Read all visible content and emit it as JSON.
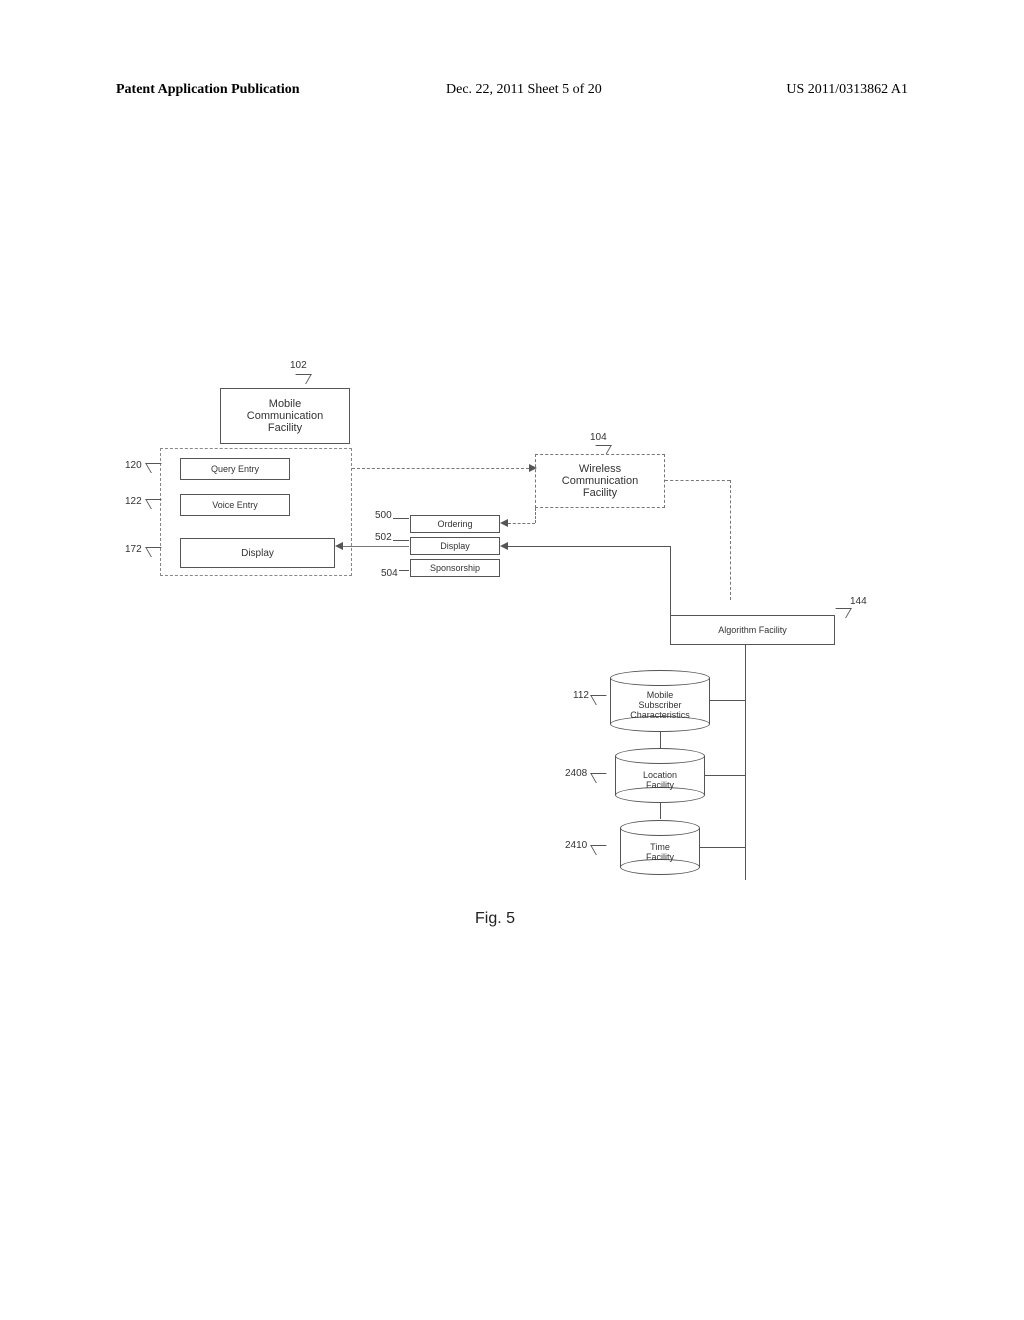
{
  "header": {
    "left": "Patent Application Publication",
    "mid": "Dec. 22, 2011  Sheet 5 of 20",
    "right": "US 2011/0313862 A1"
  },
  "labels": {
    "mobile_comm": "Mobile\nCommunication\nFacility",
    "query_entry": "Query Entry",
    "voice_entry": "Voice Entry",
    "display_left": "Display",
    "wireless": "Wireless\nCommunication\nFacility",
    "ordering": "Ordering",
    "display_mid": "Display",
    "sponsorship": "Sponsorship",
    "algorithm": "Algorithm Facility",
    "msc": "Mobile\nSubscriber\nCharacteristics",
    "location": "Location\nFacility",
    "time": "Time\nFacility",
    "fig": "Fig. 5"
  },
  "refs": {
    "r102": "102",
    "r104": "104",
    "r120": "120",
    "r122": "122",
    "r172": "172",
    "r500": "500",
    "r502": "502",
    "r504": "504",
    "r144": "144",
    "r112": "112",
    "r2408": "2408",
    "r2410": "2410"
  }
}
